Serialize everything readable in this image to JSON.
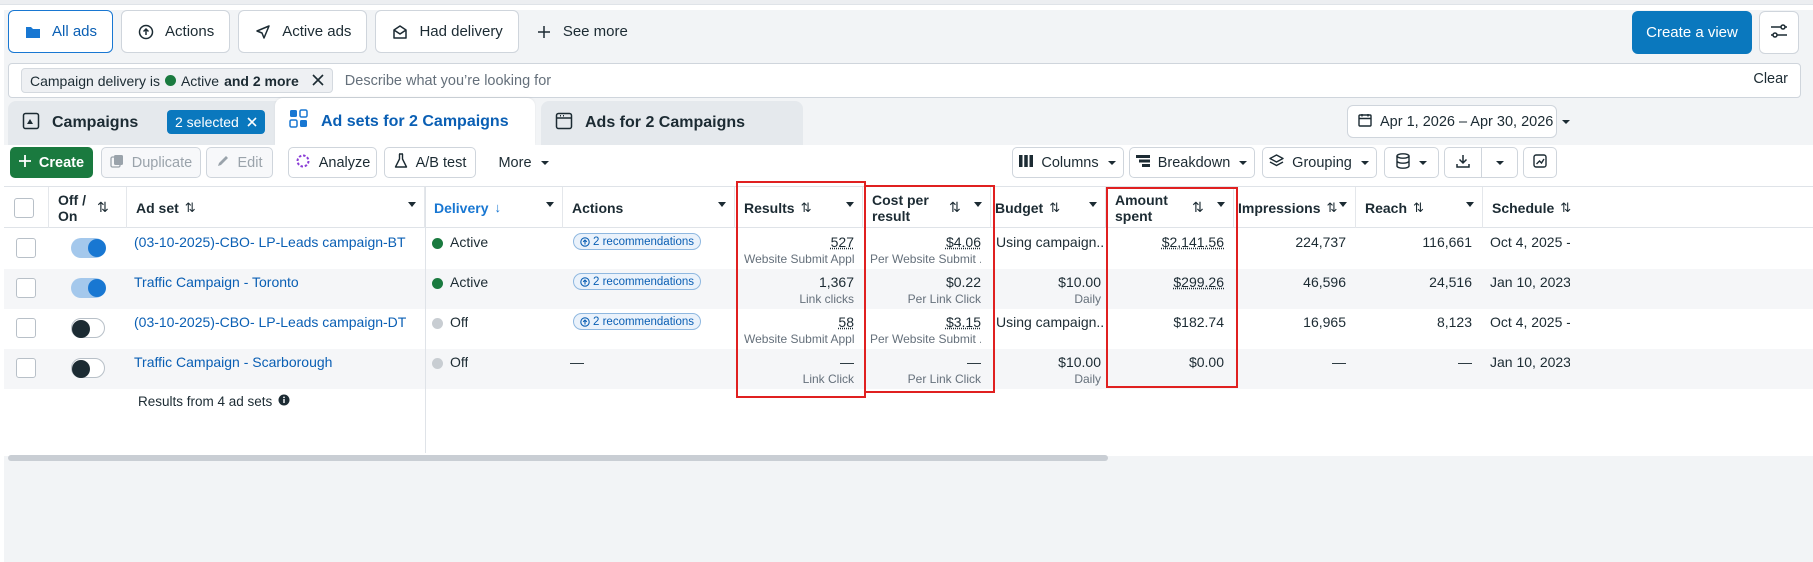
{
  "views": {
    "tabs": [
      {
        "label": "All ads",
        "icon": "folder-icon",
        "active": true
      },
      {
        "label": "Actions",
        "icon": "arrow-up-circle-icon",
        "active": false
      },
      {
        "label": "Active ads",
        "icon": "send-icon",
        "active": false
      },
      {
        "label": "Had delivery",
        "icon": "inbox-icon",
        "active": false
      }
    ],
    "see_more": "See more",
    "create_view": "Create a view"
  },
  "filter": {
    "chip_prefix": "Campaign delivery is",
    "chip_value": "Active",
    "chip_suffix": "and 2 more",
    "placeholder": "Describe what you’re looking for",
    "clear": "Clear",
    "active_color": "#1a7a3f"
  },
  "levels": {
    "campaigns": "Campaigns",
    "selected": "2 selected",
    "adsets": "Ad sets for 2 Campaigns",
    "ads": "Ads for 2 Campaigns"
  },
  "date_range": "Apr 1, 2026 – Apr 30, 2026",
  "toolbar": {
    "create": "Create",
    "duplicate": "Duplicate",
    "edit": "Edit",
    "analyze": "Analyze",
    "ab_test": "A/B test",
    "more": "More",
    "columns": "Columns",
    "breakdown": "Breakdown",
    "grouping": "Grouping"
  },
  "table": {
    "headers": {
      "offon_1": "Off /",
      "offon_2": "On",
      "adset": "Ad set",
      "delivery": "Delivery",
      "actions": "Actions",
      "results": "Results",
      "cpr_1": "Cost per",
      "cpr_2": "result",
      "budget": "Budget",
      "spent_1": "Amount",
      "spent_2": "spent",
      "impressions": "Impressions",
      "reach": "Reach",
      "schedule": "Schedule"
    },
    "rows": [
      {
        "on": true,
        "name": "(03-10-2025)-CBO- LP-Leads campaign-BT",
        "delivery": "Active",
        "delivery_color": "#1a7a3f",
        "recs": "2 recommendations",
        "results": "527",
        "results_sub": "Website Submit Appl...",
        "cpr": "$4.06",
        "cpr_sub": "Per Website Submit ...",
        "budget": "Using campaign...",
        "budget_sub": "",
        "spent": "$2,141.56",
        "impressions": "224,737",
        "reach": "116,661",
        "schedule": "Oct 4, 2025 -"
      },
      {
        "on": true,
        "name": "Traffic Campaign - Toronto",
        "delivery": "Active",
        "delivery_color": "#1a7a3f",
        "recs": "2 recommendations",
        "results": "1,367",
        "results_sub": "Link clicks",
        "cpr": "$0.22",
        "cpr_sub": "Per Link Click",
        "budget": "$10.00",
        "budget_sub": "Daily",
        "spent": "$299.26",
        "impressions": "46,596",
        "reach": "24,516",
        "schedule": "Jan 10, 2023"
      },
      {
        "on": false,
        "name": "(03-10-2025)-CBO- LP-Leads campaign-DT",
        "delivery": "Off",
        "delivery_color": "#c8cdd2",
        "recs": "2 recommendations",
        "results": "58",
        "results_sub": "Website Submit Appl...",
        "cpr": "$3.15",
        "cpr_sub": "Per Website Submit ...",
        "budget": "Using campaign...",
        "budget_sub": "",
        "spent": "$182.74",
        "impressions": "16,965",
        "reach": "8,123",
        "schedule": "Oct 4, 2025 -"
      },
      {
        "on": false,
        "name": "Traffic Campaign - Scarborough",
        "delivery": "Off",
        "delivery_color": "#c8cdd2",
        "recs": "—",
        "results": "—",
        "results_sub": "Link Click",
        "cpr": "—",
        "cpr_sub": "Per Link Click",
        "budget": "$10.00",
        "budget_sub": "Daily",
        "spent": "$0.00",
        "impressions": "—",
        "reach": "—",
        "schedule": "Jan 10, 2023"
      }
    ],
    "footer": "Results from 4 ad sets"
  },
  "colors": {
    "accent": "#0a78be",
    "link": "#0a5fb4",
    "create_green": "#1a7a3f",
    "highlight": "#e02020"
  }
}
